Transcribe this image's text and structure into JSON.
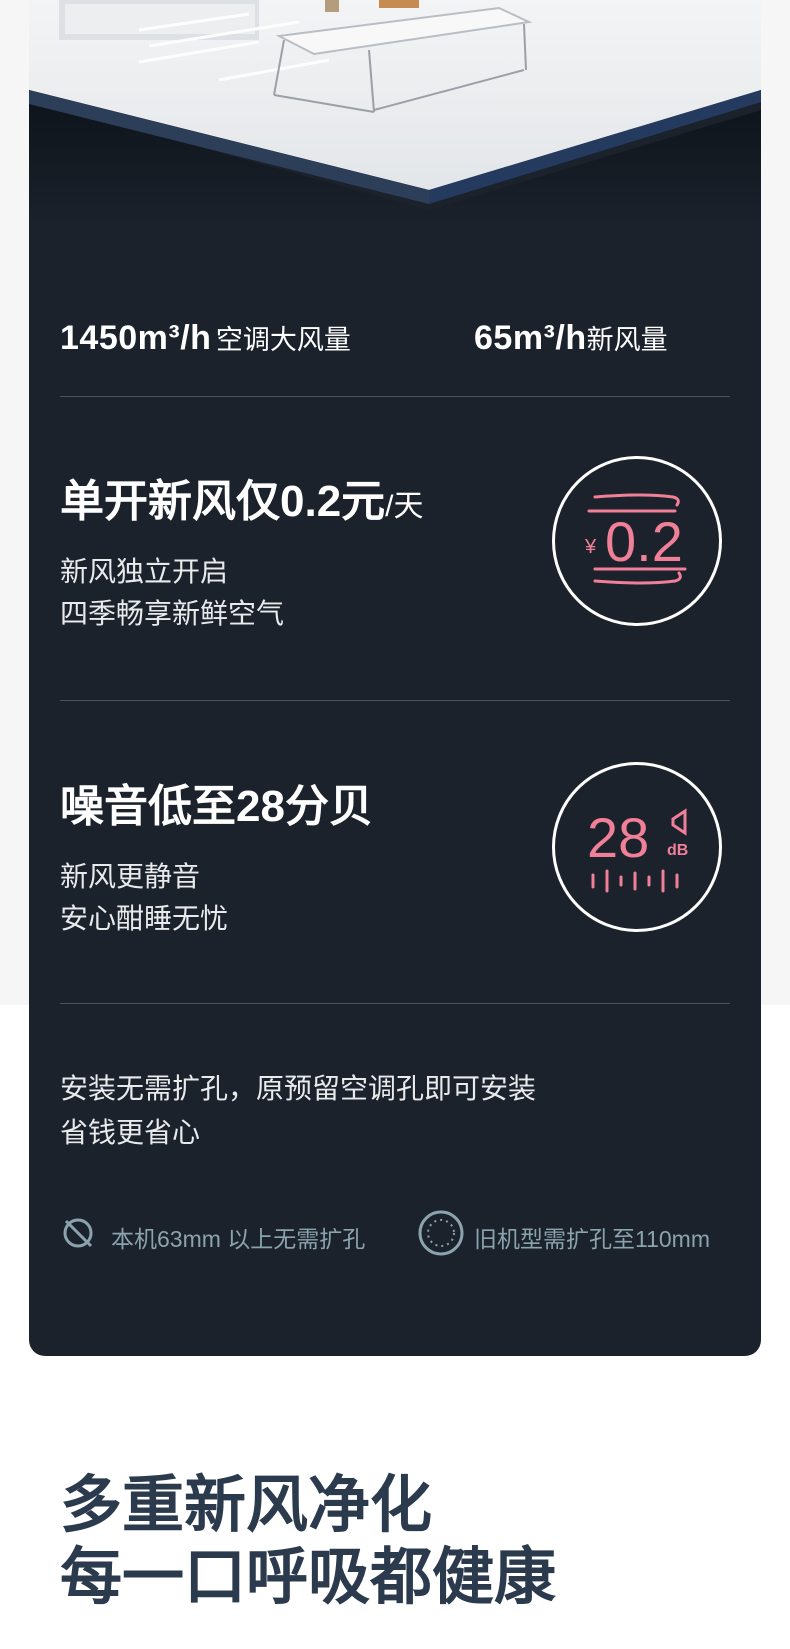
{
  "stats": {
    "airflow_value": "1450m³/h",
    "airflow_label": "空调大风量",
    "fresh_value": "65m³/h",
    "fresh_label": "新风量"
  },
  "feature_cost": {
    "title": "单开新风仅0.2元",
    "title_unit": "/天",
    "desc_line1": "新风独立开启",
    "desc_line2": "四季畅享新鲜空气",
    "badge_symbol": "¥",
    "badge_value": "0.2",
    "badge_color": "#f07f98"
  },
  "feature_noise": {
    "title": "噪音低至28分贝",
    "desc_line1": "新风更静音",
    "desc_line2": "安心酣睡无忧",
    "badge_value": "28",
    "badge_unit": "dB",
    "badge_color": "#f07f98"
  },
  "install": {
    "line1": "安装无需扩孔，原预留空调孔即可安装",
    "line2": "省钱更省心"
  },
  "notes": {
    "note1_icon": "no-drill-icon",
    "note1": "本机63mm 以上无需扩孔",
    "note2_icon": "drill-hole-icon",
    "note2": "旧机型需扩孔至110mm"
  },
  "headline": {
    "line1": "多重新风净化",
    "line2": "每一口呼吸都健康"
  },
  "colors": {
    "card_bg": "#1b222c",
    "accent": "#f07f98",
    "note_text": "#8aa3ac",
    "headline": "#2b3a4d"
  }
}
